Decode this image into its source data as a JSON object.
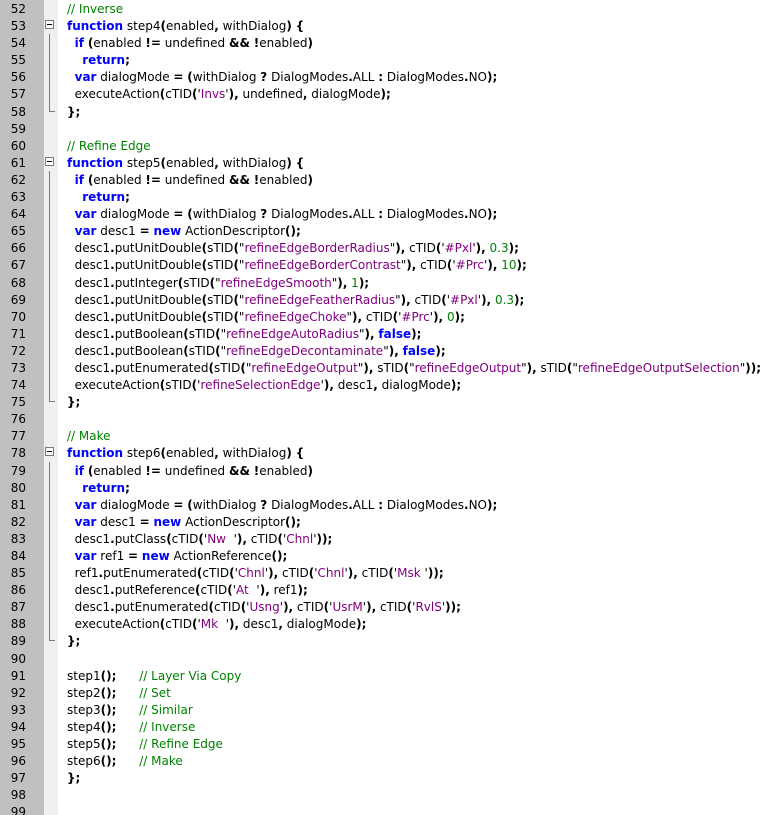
{
  "editor": {
    "language": "javascript",
    "colors": {
      "keyword": "#0000ff",
      "string": "#800080",
      "number": "#008000",
      "comment": "#008000",
      "gutter": "#c0c0c0",
      "fold_margin": "#f0f0f0"
    },
    "lines": [
      {
        "n": "52",
        "text": "// Inverse"
      },
      {
        "n": "53",
        "text": "function step4(enabled, withDialog) {"
      },
      {
        "n": "54",
        "text": "  if (enabled != undefined && !enabled)"
      },
      {
        "n": "55",
        "text": "    return;"
      },
      {
        "n": "56",
        "text": "  var dialogMode = (withDialog ? DialogModes.ALL : DialogModes.NO);"
      },
      {
        "n": "57",
        "text": "  executeAction(cTID('Invs'), undefined, dialogMode);"
      },
      {
        "n": "58",
        "text": "};"
      },
      {
        "n": "59",
        "text": ""
      },
      {
        "n": "60",
        "text": "// Refine Edge"
      },
      {
        "n": "61",
        "text": "function step5(enabled, withDialog) {"
      },
      {
        "n": "62",
        "text": "  if (enabled != undefined && !enabled)"
      },
      {
        "n": "63",
        "text": "    return;"
      },
      {
        "n": "64",
        "text": "  var dialogMode = (withDialog ? DialogModes.ALL : DialogModes.NO);"
      },
      {
        "n": "65",
        "text": "  var desc1 = new ActionDescriptor();"
      },
      {
        "n": "66",
        "text": "  desc1.putUnitDouble(sTID(\"refineEdgeBorderRadius\"), cTID('#Pxl'), 0.3);"
      },
      {
        "n": "67",
        "text": "  desc1.putUnitDouble(sTID(\"refineEdgeBorderContrast\"), cTID('#Prc'), 10);"
      },
      {
        "n": "68",
        "text": "  desc1.putInteger(sTID(\"refineEdgeSmooth\"), 1);"
      },
      {
        "n": "69",
        "text": "  desc1.putUnitDouble(sTID(\"refineEdgeFeatherRadius\"), cTID('#Pxl'), 0.3);"
      },
      {
        "n": "70",
        "text": "  desc1.putUnitDouble(sTID(\"refineEdgeChoke\"), cTID('#Prc'), 0);"
      },
      {
        "n": "71",
        "text": "  desc1.putBoolean(sTID(\"refineEdgeAutoRadius\"), false);"
      },
      {
        "n": "72",
        "text": "  desc1.putBoolean(sTID(\"refineEdgeDecontaminate\"), false);"
      },
      {
        "n": "73",
        "text": "  desc1.putEnumerated(sTID(\"refineEdgeOutput\"), sTID(\"refineEdgeOutput\"), sTID(\"refineEdgeOutputSelection\"));"
      },
      {
        "n": "74",
        "text": "  executeAction(sTID('refineSelectionEdge'), desc1, dialogMode);"
      },
      {
        "n": "75",
        "text": "};"
      },
      {
        "n": "76",
        "text": ""
      },
      {
        "n": "77",
        "text": "// Make"
      },
      {
        "n": "78",
        "text": "function step6(enabled, withDialog) {"
      },
      {
        "n": "79",
        "text": "  if (enabled != undefined && !enabled)"
      },
      {
        "n": "80",
        "text": "    return;"
      },
      {
        "n": "81",
        "text": "  var dialogMode = (withDialog ? DialogModes.ALL : DialogModes.NO);"
      },
      {
        "n": "82",
        "text": "  var desc1 = new ActionDescriptor();"
      },
      {
        "n": "83",
        "text": "  desc1.putClass(cTID('Nw  '), cTID('Chnl'));"
      },
      {
        "n": "84",
        "text": "  var ref1 = new ActionReference();"
      },
      {
        "n": "85",
        "text": "  ref1.putEnumerated(cTID('Chnl'), cTID('Chnl'), cTID('Msk '));"
      },
      {
        "n": "86",
        "text": "  desc1.putReference(cTID('At  '), ref1);"
      },
      {
        "n": "87",
        "text": "  desc1.putEnumerated(cTID('Usng'), cTID('UsrM'), cTID('RvlS'));"
      },
      {
        "n": "88",
        "text": "  executeAction(cTID('Mk  '), desc1, dialogMode);"
      },
      {
        "n": "89",
        "text": "};"
      },
      {
        "n": "90",
        "text": ""
      },
      {
        "n": "91",
        "text": "step1();      // Layer Via Copy"
      },
      {
        "n": "92",
        "text": "step2();      // Set"
      },
      {
        "n": "93",
        "text": "step3();      // Similar"
      },
      {
        "n": "94",
        "text": "step4();      // Inverse"
      },
      {
        "n": "95",
        "text": "step5();      // Refine Edge"
      },
      {
        "n": "96",
        "text": "step6();      // Make"
      },
      {
        "n": "97",
        "text": "};"
      },
      {
        "n": "98",
        "text": ""
      },
      {
        "n": "99",
        "text": ""
      }
    ]
  }
}
